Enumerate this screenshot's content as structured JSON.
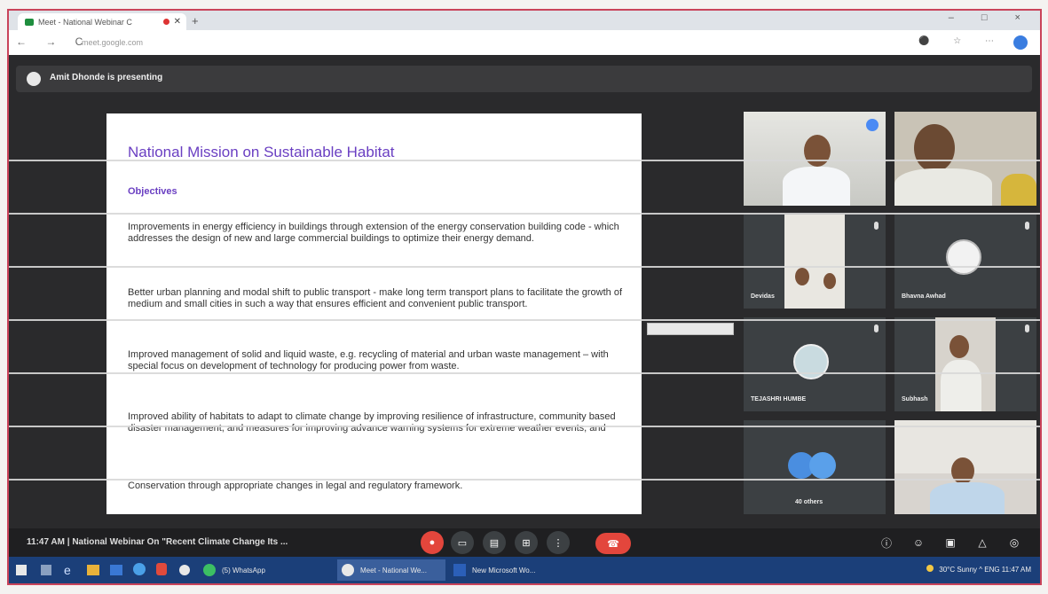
{
  "browser": {
    "tab_title": "Meet - National Webinar C",
    "new_tab": "+",
    "window_controls": "– □ ×",
    "nav_glyphs": "← → C",
    "url": "meet.google.com"
  },
  "meet": {
    "presenter_text": "Amit Dhonde is presenting",
    "slide": {
      "title": "National Mission on Sustainable Habitat",
      "subtitle": "Objectives",
      "paragraphs": [
        "Improvements in energy efficiency in buildings through extension of the energy conservation building code - which addresses the design of new and large commercial buildings to optimize their energy demand.",
        "Better urban planning and modal shift to public transport - make long term transport plans to facilitate the growth of medium and small cities in such a way that ensures efficient and convenient public transport.",
        "Improved management of solid and liquid waste, e.g. recycling of material and urban waste management – with special focus on development of technology for producing power from waste.",
        "Improved ability of habitats to adapt to climate change by improving resilience of infrastructure, community based disaster management, and measures for improving advance warning systems for extreme weather events, and",
        "Conservation through appropriate changes in legal and regulatory framework."
      ]
    },
    "participants": [
      {
        "name": ""
      },
      {
        "name": ""
      },
      {
        "name": "Devidas"
      },
      {
        "name": "Bhavna Awhad"
      },
      {
        "name": "TEJASHRI HUMBE"
      },
      {
        "name": "Subhash"
      },
      {
        "name": "40 others"
      },
      {
        "name": ""
      }
    ],
    "meeting_info": "11:47 AM  |  National Webinar On \"Recent Climate Change Its ..."
  },
  "colors": {
    "accent": "#6a3fc2",
    "hangup": "#e3463c",
    "frame_border": "#c9435a",
    "taskbar": "#1b3f79"
  },
  "taskbar": {
    "apps": [
      {
        "label": "(5) WhatsApp"
      },
      {
        "label": "Meet - National We..."
      },
      {
        "label": "New Microsoft Wo..."
      }
    ],
    "tray_text": "30°C Sunny  ^  ENG   11:47 AM"
  }
}
